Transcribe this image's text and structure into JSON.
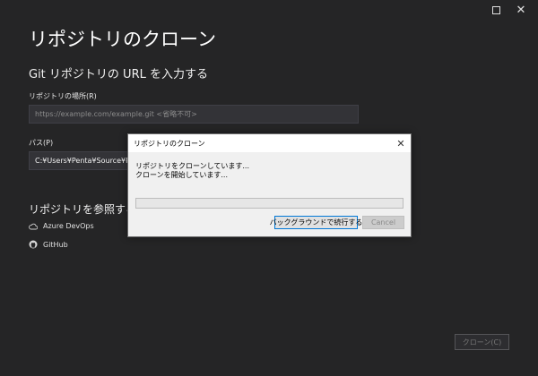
{
  "window": {
    "maximize_icon": "maximize-icon",
    "close_icon": "close-icon"
  },
  "page": {
    "title": "リポジトリのクローン",
    "subtitle": "Git リポジトリの URL を入力する",
    "repo_location_label": "リポジトリの場所(R)",
    "repo_location_placeholder": "https://example.com/example.git <省略不可>",
    "repo_location_value": "",
    "path_label": "パス(P)",
    "path_value": "C:¥Users¥Penta¥Source¥Repos",
    "browse_section_title": "リポジトリを参照する",
    "providers": [
      {
        "label": "Azure DevOps",
        "icon": "cloud-icon"
      },
      {
        "label": "GitHub",
        "icon": "github-icon"
      }
    ],
    "clone_button": "クローン(C)"
  },
  "dialog": {
    "title": "リポジトリのクローン",
    "message_1": "リポジトリをクローンしています...",
    "message_2": "クローンを開始しています...",
    "progress": 0,
    "background_button": "バックグラウンドで続行する",
    "cancel_button": "Cancel",
    "accent": "#0078d7"
  }
}
